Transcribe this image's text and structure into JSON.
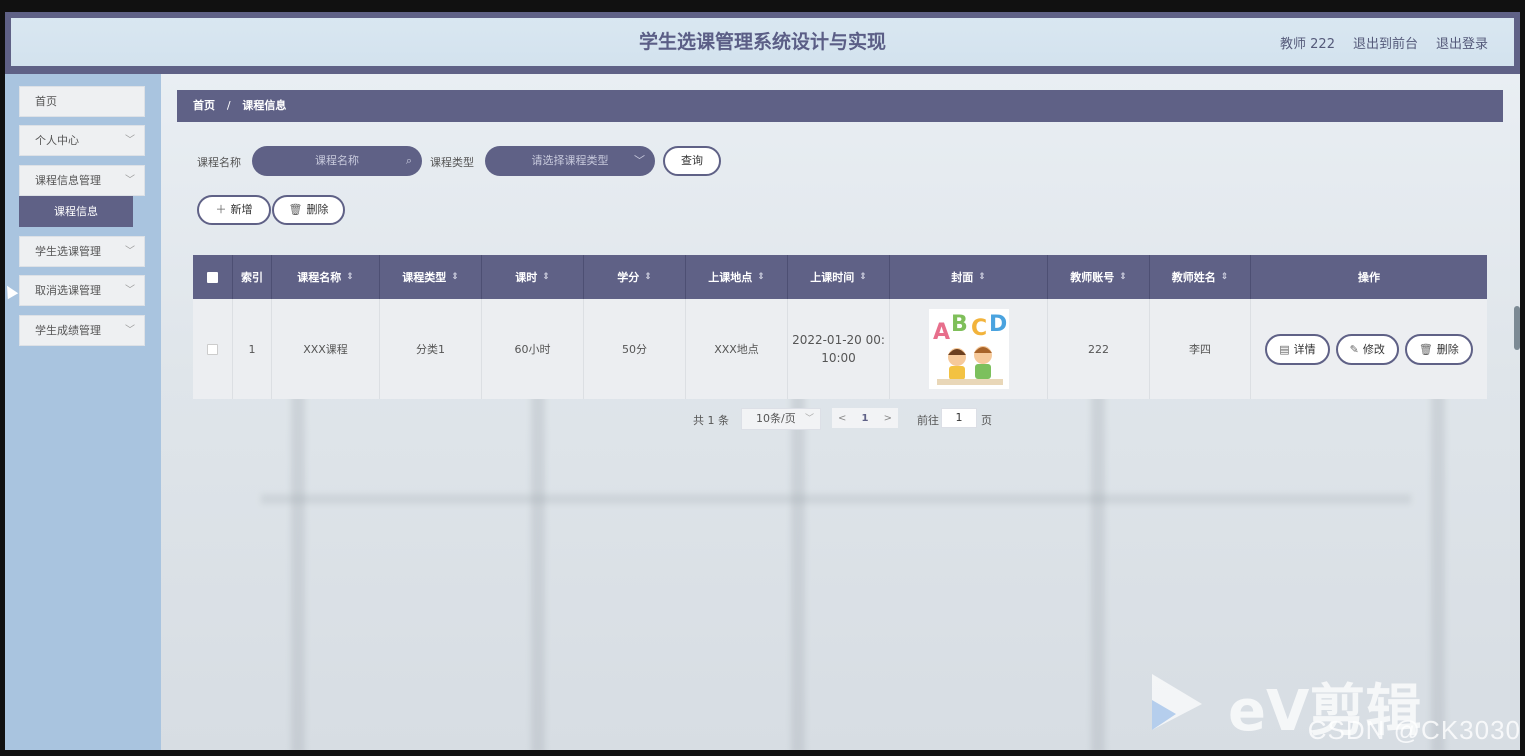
{
  "header": {
    "title": "学生选课管理系统设计与实现",
    "user_label": "教师 222",
    "back_to_front": "退出到前台",
    "logout": "退出登录"
  },
  "sidebar": {
    "items": [
      {
        "label": "首页",
        "has_chevron": false
      },
      {
        "label": "个人中心",
        "has_chevron": true
      },
      {
        "label": "课程信息管理",
        "has_chevron": true
      },
      {
        "label": "学生选课管理",
        "has_chevron": true
      },
      {
        "label": "取消选课管理",
        "has_chevron": true
      },
      {
        "label": "学生成绩管理",
        "has_chevron": true
      }
    ],
    "submenu": {
      "label": "课程信息"
    }
  },
  "breadcrumb": {
    "home": "首页",
    "separator": "/",
    "current": "课程信息"
  },
  "search": {
    "course_name_label": "课程名称",
    "course_name_placeholder": "课程名称",
    "course_type_label": "课程类型",
    "course_type_placeholder": "请选择课程类型",
    "query_button": "查询"
  },
  "actions": {
    "add": "新增",
    "delete": "删除"
  },
  "table": {
    "headers": [
      "索引",
      "课程名称",
      "课程类型",
      "课时",
      "学分",
      "上课地点",
      "上课时间",
      "封面",
      "教师账号",
      "教师姓名",
      "操作"
    ],
    "rows": [
      {
        "index": "1",
        "course_name": "XXX课程",
        "course_type": "分类1",
        "hours": "60小时",
        "credits": "50分",
        "location": "XXX地点",
        "time_line1": "2022-01-20 00:",
        "time_line2": "10:00",
        "cover_letters": [
          "A",
          "B",
          "C",
          "D"
        ],
        "teacher_account": "222",
        "teacher_name": "李四",
        "ops": {
          "detail": "详情",
          "edit": "修改",
          "delete": "删除"
        }
      }
    ]
  },
  "pagination": {
    "total": "共 1 条",
    "page_size": "10条/页",
    "prev": "<",
    "current_page": "1",
    "next": ">",
    "goto_label": "前往",
    "goto_value": "1",
    "page_unit": "页"
  },
  "watermark": {
    "csdn": "CSDN @CK3030",
    "ev": "eV剪辑"
  },
  "colors": {
    "accent": "#5f6186",
    "sidebar": "#a9c4df",
    "header": "#d6e4ef"
  }
}
